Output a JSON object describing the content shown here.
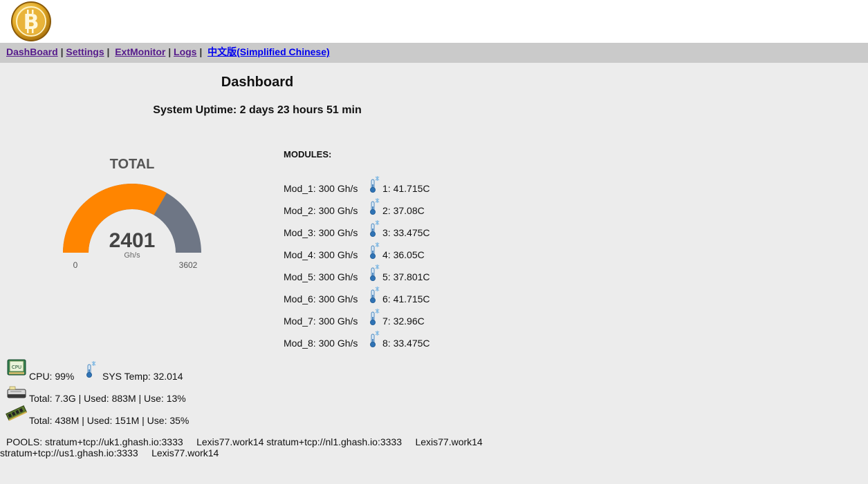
{
  "nav": {
    "dashboard": "DashBoard",
    "settings": "Settings",
    "extmonitor": "ExtMonitor",
    "logs": "Logs",
    "chinese": "中文版(Simplified Chinese)",
    "sep": "|"
  },
  "page": {
    "title": "Dashboard",
    "uptime": "System Uptime: 2 days 23 hours 51 min"
  },
  "gauge": {
    "title": "TOTAL",
    "value": 2401,
    "value_text": "2401",
    "unit": "Gh/s",
    "min": 0,
    "max": 3602,
    "min_text": "0",
    "max_text": "3602",
    "fill_color": "#ff8500",
    "rest_color": "#6e7685"
  },
  "modules": {
    "title": "MODULES:",
    "items": [
      {
        "rate": "Mod_1: 300 Gh/s",
        "temp": "1: 41.715C"
      },
      {
        "rate": "Mod_2: 300 Gh/s",
        "temp": "2: 37.08C"
      },
      {
        "rate": "Mod_3: 300 Gh/s",
        "temp": "3: 33.475C"
      },
      {
        "rate": "Mod_4: 300 Gh/s",
        "temp": "4: 36.05C"
      },
      {
        "rate": "Mod_5: 300 Gh/s",
        "temp": "5: 37.801C"
      },
      {
        "rate": "Mod_6: 300 Gh/s",
        "temp": "6: 41.715C"
      },
      {
        "rate": "Mod_7: 300 Gh/s",
        "temp": "7: 32.96C"
      },
      {
        "rate": "Mod_8: 300 Gh/s",
        "temp": "8: 33.475C"
      }
    ]
  },
  "system": {
    "cpu": "CPU: 99%",
    "cpu_icon_text": "CPU",
    "sys_temp": "SYS Temp: 32.014",
    "disk": "Total: 7.3G | Used: 883M | Use: 13%",
    "memory": "Total: 438M | Used: 151M | Use: 35%"
  },
  "pools": {
    "line1": "POOLS: stratum+tcp://uk1.ghash.io:3333     Lexis77.work14 stratum+tcp://nl1.ghash.io:3333     Lexis77.work14",
    "line2": "stratum+tcp://us1.ghash.io:3333     Lexis77.work14"
  },
  "icons": {
    "logo": "bitcoin-logo-icon",
    "thermometer": "thermometer-icon",
    "cpu": "cpu-chip-icon",
    "disk": "hard-disk-icon",
    "memory": "memory-module-icon"
  }
}
